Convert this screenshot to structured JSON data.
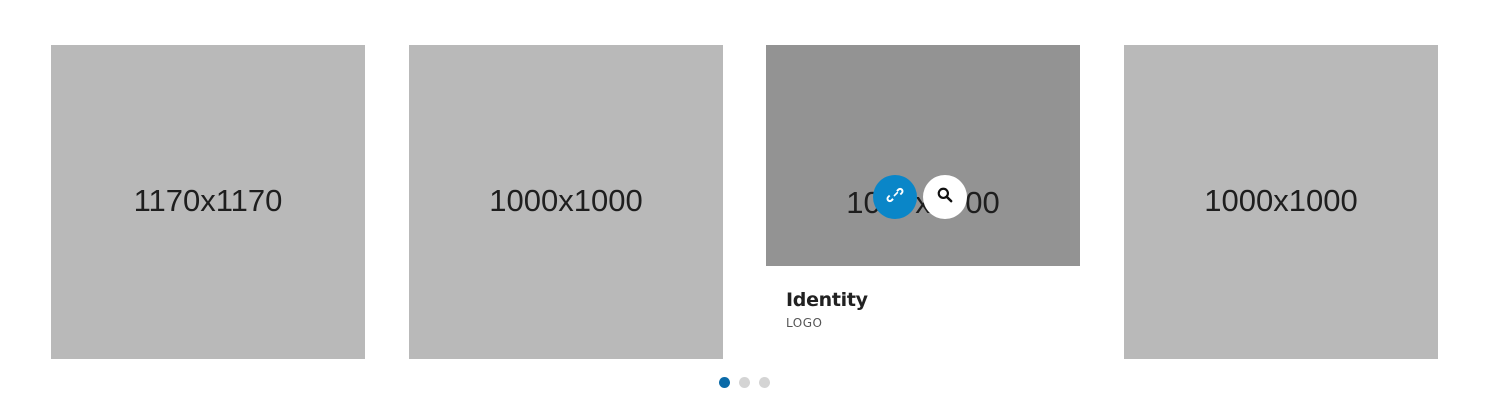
{
  "carousel": {
    "items": [
      {
        "image_label": "1170x1170"
      },
      {
        "image_label": "1000x1000"
      },
      {
        "image_label": "1000x1000",
        "title": "Identity",
        "category": "LOGO",
        "link_icon": "link-icon",
        "zoom_icon": "magnifier-icon"
      },
      {
        "image_label": "1000x1000"
      }
    ],
    "pagination": {
      "count": 3,
      "active_index": 0
    }
  },
  "colors": {
    "accent": "#0a86c8",
    "active_dot": "#0a6aa8",
    "placeholder": "#b9b9b9",
    "placeholder_hover": "#939393"
  }
}
